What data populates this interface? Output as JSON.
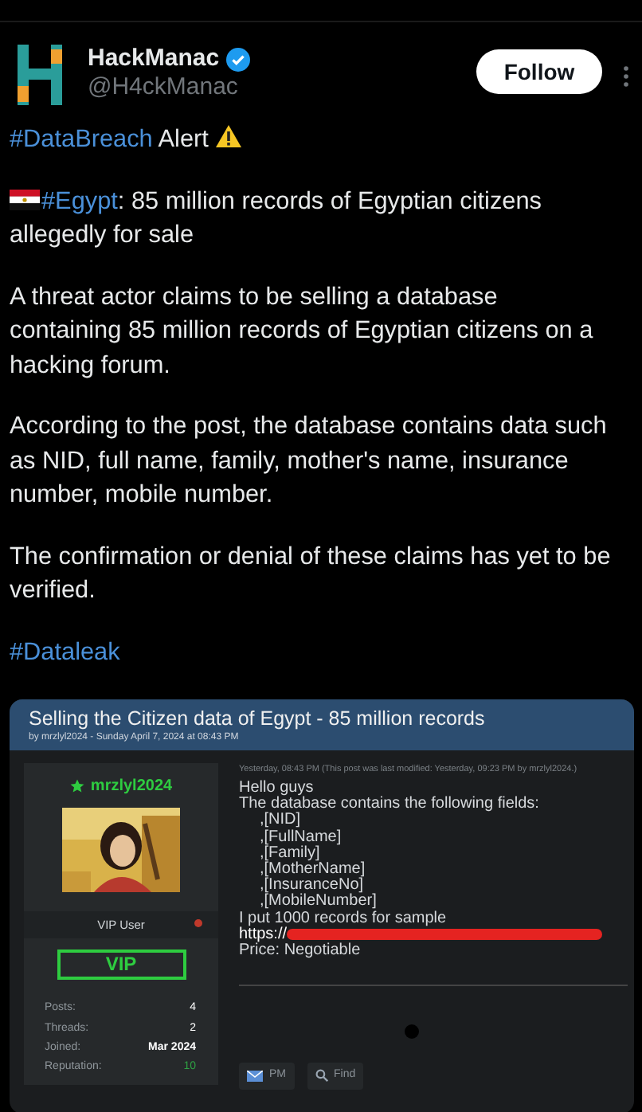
{
  "author": {
    "name": "HackManac",
    "verified": true,
    "handle": "@H4ckManac"
  },
  "follow_button": "Follow",
  "paragraphs": [
    [
      {
        "kind": "hashtag",
        "text": "#DataBreach"
      },
      {
        "kind": "text",
        "text": " Alert "
      },
      {
        "kind": "warning-icon"
      }
    ],
    [
      {
        "kind": "flag-icon"
      },
      {
        "kind": "hashtag",
        "text": "#Egypt"
      },
      {
        "kind": "text",
        "text": ": 85 million records of Egyptian citizens allegedly for sale"
      }
    ],
    [
      {
        "kind": "text",
        "text": "A threat actor claims to be selling a database containing 85 million records of Egyptian citizens on a hacking forum."
      }
    ],
    [
      {
        "kind": "text",
        "text": "According to the post, the database contains data such as NID, full name, family, mother's name, insurance number, mobile number."
      }
    ],
    [
      {
        "kind": "text",
        "text": "The confirmation or denial of these claims has yet to be verified."
      }
    ],
    [
      {
        "kind": "hashtag",
        "text": "#Dataleak"
      }
    ]
  ],
  "forum": {
    "title": "Selling the Citizen data of Egypt - 85 million records",
    "byline": "by mrzlyl2024 - Sunday April 7, 2024 at 08:43 PM",
    "user": {
      "name": "mrzlyl2024",
      "rank": "VIP User",
      "online": false,
      "badge": "VIP",
      "stats": [
        {
          "label": "Posts:",
          "value": "4",
          "color": "#ffffff"
        },
        {
          "label": "Threads:",
          "value": "2",
          "color": "#ffffff"
        },
        {
          "label": "Joined:",
          "value": "Mar 2024",
          "color": "#ffffff"
        },
        {
          "label": "Reputation:",
          "value": "10",
          "color": "#2ea043"
        }
      ]
    },
    "post": {
      "meta": "Yesterday, 08:43 PM (This post was last modified: Yesterday, 09:23 PM by mrzlyl2024.)",
      "lines": [
        {
          "kind": "text",
          "text": "Hello guys"
        },
        {
          "kind": "text",
          "text": "The database contains the following fields:"
        },
        {
          "kind": "field",
          "text": ",[NID]"
        },
        {
          "kind": "field",
          "text": ",[FullName]"
        },
        {
          "kind": "field",
          "text": ",[Family]"
        },
        {
          "kind": "field",
          "text": ",[MotherName]"
        },
        {
          "kind": "field",
          "text": ",[InsuranceNo]"
        },
        {
          "kind": "field",
          "text": ",[MobileNumber]"
        },
        {
          "kind": "text",
          "text": "I put 1000 records for sample"
        },
        {
          "kind": "link",
          "text": "https://",
          "redacted": true
        },
        {
          "kind": "text",
          "text": "Price: Negotiable"
        }
      ]
    },
    "buttons": [
      {
        "kind": "pm",
        "label": "PM"
      },
      {
        "kind": "find",
        "label": "Find"
      }
    ]
  }
}
